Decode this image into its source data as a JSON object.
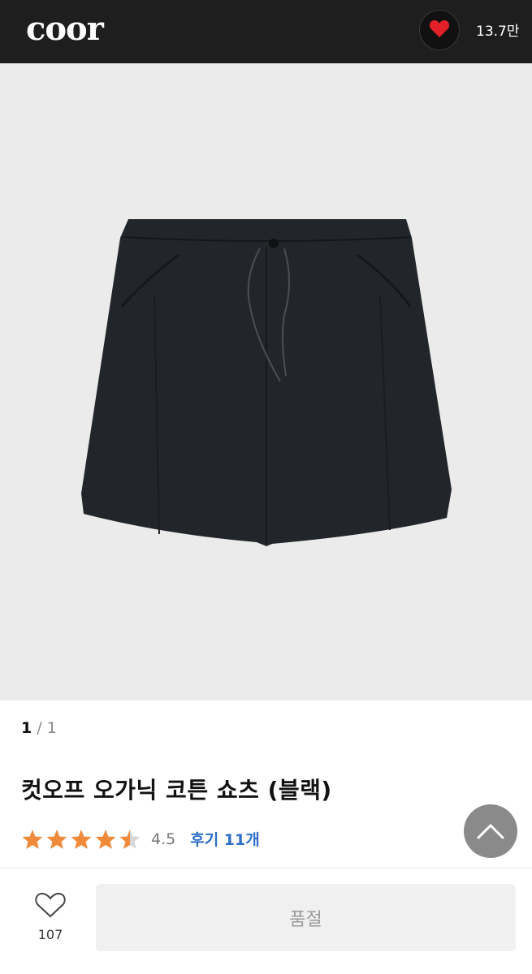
{
  "header": {
    "logo": "coor",
    "like_count": "13.7만"
  },
  "gallery": {
    "current": "1",
    "separator": " / ",
    "total": "1"
  },
  "product": {
    "title": "컷오프 오가닉 코튼 쇼츠 (블랙)",
    "rating": 4.5,
    "rating_label": "4.5",
    "reviews_label": "후기 11개"
  },
  "bottom_bar": {
    "wish_count": "107",
    "purchase_label": "품절"
  },
  "colors": {
    "header_bg": "#1e1e1e",
    "heart": "#e2202a",
    "star": "#ef8a3a",
    "review_link": "#2f6fc7",
    "image_bg": "#ebebeb",
    "shorts": "#22262b"
  },
  "icons": {
    "header_heart": "heart-icon",
    "scroll_top": "chevron-up-icon",
    "wish": "heart-outline-icon"
  }
}
